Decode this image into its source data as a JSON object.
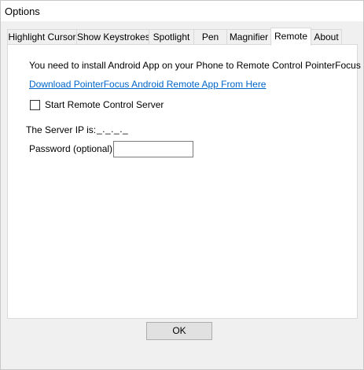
{
  "window": {
    "title": "Options"
  },
  "tabs": [
    {
      "label": "Highlight Cursor",
      "active": false
    },
    {
      "label": "Show Keystrokes",
      "active": false
    },
    {
      "label": "Spotlight",
      "active": false
    },
    {
      "label": "Pen",
      "active": false
    },
    {
      "label": "Magnifier",
      "active": false
    },
    {
      "label": "Remote",
      "active": true
    },
    {
      "label": "About",
      "active": false
    }
  ],
  "remote": {
    "info_text": "You need to install Android App on your Phone to Remote Control PointerFocus",
    "download_link": "Download PointerFocus Android Remote App From Here",
    "start_server_label": "Start Remote Control Server",
    "start_server_checked": false,
    "server_ip_label": "The Server IP is:",
    "server_ip_value": "_._._._",
    "password_label": "Password (optional):",
    "password_value": ""
  },
  "footer": {
    "ok_label": "OK"
  },
  "colors": {
    "link": "#0066cc",
    "panel_bg": "#ffffff",
    "window_bg": "#f0f0f0",
    "tab_border": "#d9d9d9"
  }
}
